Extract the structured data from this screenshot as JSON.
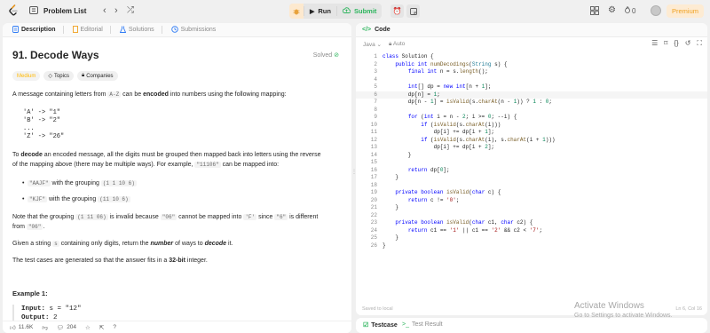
{
  "topbar": {
    "problem_list_label": "Problem List",
    "run_label": "Run",
    "submit_label": "Submit",
    "streak_count": "0",
    "premium_label": "Premium"
  },
  "left_tabs": [
    "Description",
    "Editorial",
    "Solutions",
    "Submissions"
  ],
  "problem": {
    "title": "91. Decode Ways",
    "status": "Solved",
    "difficulty": "Medium",
    "topics_label": "Topics",
    "companies_label": "Companies",
    "p1_pre": "A message containing letters from ",
    "p1_code": "A-Z",
    "p1_mid": " can be ",
    "p1_bold": "encoded",
    "p1_post": " into numbers using the following mapping:",
    "mapping": [
      "'A' -> \"1\"",
      "'B' -> \"2\"",
      "...",
      "'Z' -> \"26\""
    ],
    "p2_a": "To ",
    "p2_bold": "decode",
    "p2_b": " an encoded message, all the digits must be grouped then mapped back into letters using the reverse",
    "p2_c": "of the mapping above (there may be multiple ways). For example, ",
    "p2_code": "\"11106\"",
    "p2_d": " can be mapped into:",
    "bullet1_code1": "\"AAJF\"",
    "bullet1_text": " with the grouping ",
    "bullet1_code2": "(1 1 10 6)",
    "bullet2_code1": "\"KJF\"",
    "bullet2_text": " with the grouping ",
    "bullet2_code2": "(11 10 6)",
    "p3_a": "Note that the grouping ",
    "p3_code1": "(1 11 06)",
    "p3_b": " is invalid because ",
    "p3_code2": "\"06\"",
    "p3_c": " cannot be mapped into ",
    "p3_code3": "'F'",
    "p3_d": " since ",
    "p3_code4": "\"6\"",
    "p3_e": " is different",
    "p3_f": "from ",
    "p3_code5": "\"06\"",
    "p3_g": ".",
    "p4_a": "Given a string ",
    "p4_code": "s",
    "p4_b": " containing only digits, return the ",
    "p4_bold1": "number",
    "p4_c": " of ways to ",
    "p4_bold2": "decode",
    "p4_d": " it.",
    "p5_a": "The test cases are generated so that the answer fits in a ",
    "p5_bold": "32-bit",
    "p5_b": " integer.",
    "example_title": "Example 1:",
    "example_input_label": "Input:",
    "example_input_value": " s = \"12\"",
    "example_output_label": "Output:",
    "example_output_value": " 2"
  },
  "left_footer": {
    "likes": "11.6K",
    "comments": "204"
  },
  "code_panel": {
    "tab_label": "Code",
    "language": "Java",
    "mode": "Auto",
    "saved_text": "Saved to local",
    "cursor_pos": "Ln 6, Col 16"
  },
  "code_lines": [
    "class Solution {",
    "    public int numDecodings(String s) {",
    "        final int n = s.length();",
    "",
    "        int[] dp = new int[n + 1];",
    "        dp[n] = 1;",
    "        dp[n - 1] = isValid(s.charAt(n - 1)) ? 1 : 0;",
    "",
    "        for (int i = n - 2; i >= 0; --i) {",
    "            if (isValid(s.charAt(i)))",
    "                dp[i] += dp[i + 1];",
    "            if (isValid(s.charAt(i), s.charAt(i + 1)))",
    "                dp[i] += dp[i + 2];",
    "        }",
    "",
    "        return dp[0];",
    "    }",
    "",
    "    private boolean isValid(char c) {",
    "        return c != '0';",
    "    }",
    "",
    "    private boolean isValid(char c1, char c2) {",
    "        return c1 == '1' || c1 == '2' && c2 < '7';",
    "    }",
    "}"
  ],
  "bottom_tabs": [
    "Testcase",
    "Test Result"
  ],
  "watermark": {
    "line1": "Activate Windows",
    "line2": "Go to Settings to activate Windows."
  }
}
